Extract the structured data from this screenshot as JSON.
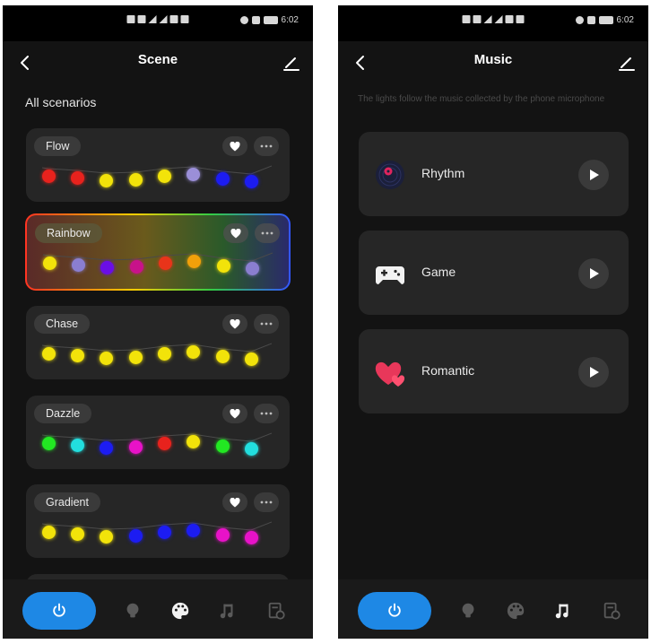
{
  "colors": {
    "accent": "#1e88e5",
    "card": "#262626",
    "background": "#131313"
  },
  "status_bar": {
    "time": "6:02"
  },
  "scene_screen": {
    "title": "Scene",
    "section_title": "All scenarios",
    "scenes": [
      {
        "label": "Flow",
        "selected": false,
        "bulbs": [
          "#e8221d",
          "#e8221d",
          "#f2e30a",
          "#f2e30a",
          "#f2e30a",
          "#9b8fd8",
          "#1c1cf2",
          "#1c1cf2"
        ]
      },
      {
        "label": "Rainbow",
        "selected": true,
        "bulbs": [
          "#f2e30a",
          "#8a7ed0",
          "#6a0ee6",
          "#c8128a",
          "#e8341a",
          "#f2a00a",
          "#f2e30a",
          "#8a7ed0"
        ]
      },
      {
        "label": "Chase",
        "selected": false,
        "bulbs": [
          "#f2e30a",
          "#f2e30a",
          "#f2e30a",
          "#f2e30a",
          "#f2e30a",
          "#f2e30a",
          "#f2e30a",
          "#f2e30a"
        ]
      },
      {
        "label": "Dazzle",
        "selected": false,
        "bulbs": [
          "#22e822",
          "#22dede",
          "#1c1cf2",
          "#e812c8",
          "#e8221d",
          "#f2e30a",
          "#22e822",
          "#22dede"
        ]
      },
      {
        "label": "Gradient",
        "selected": false,
        "bulbs": [
          "#f2e30a",
          "#f2e30a",
          "#f2e30a",
          "#1c1cf2",
          "#1c1cf2",
          "#1c1cf2",
          "#e812c8",
          "#e812c8"
        ]
      }
    ]
  },
  "music_screen": {
    "title": "Music",
    "hint": "The lights follow the music collected by the phone microphone",
    "modes": [
      {
        "label": "Rhythm",
        "icon": "vinyl-record-icon"
      },
      {
        "label": "Game",
        "icon": "gamepad-icon"
      },
      {
        "label": "Romantic",
        "icon": "hearts-icon"
      }
    ]
  },
  "bottom_nav": {
    "items": [
      "power-icon",
      "bulb-icon",
      "palette-icon",
      "music-note-icon",
      "schedule-icon"
    ],
    "scene_screen_active": "palette-icon",
    "music_screen_active": "music-note-icon"
  }
}
